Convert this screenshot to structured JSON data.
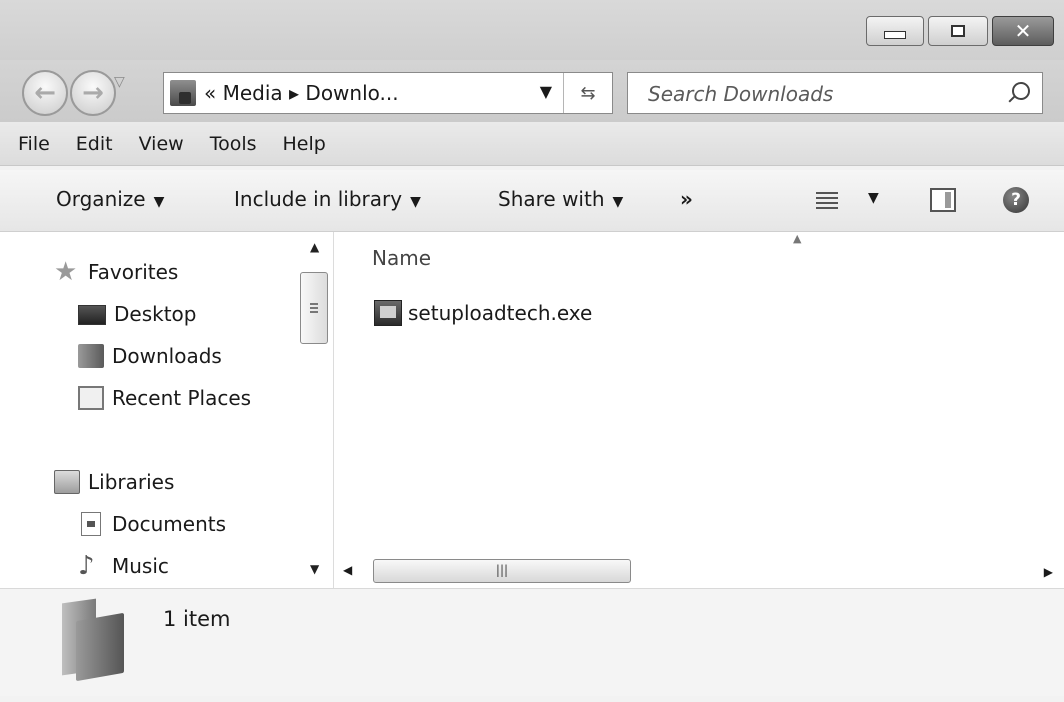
{
  "window": {
    "controls": {
      "minimize": "minimize-icon",
      "restore": "restore-icon",
      "close": "close-icon"
    }
  },
  "nav": {
    "address": {
      "path_text": "« Media ▸ Downlo..."
    },
    "search": {
      "placeholder": "Search Downloads"
    }
  },
  "menubar": {
    "items": [
      "File",
      "Edit",
      "View",
      "Tools",
      "Help"
    ]
  },
  "toolbar": {
    "organize": "Organize",
    "include_in_library": "Include in library",
    "share_with": "Share with",
    "more": "»"
  },
  "sidebar": {
    "favorites_header": "Favorites",
    "favorites": [
      "Desktop",
      "Downloads",
      "Recent Places"
    ],
    "libraries_header": "Libraries",
    "libraries": [
      "Documents",
      "Music"
    ]
  },
  "content": {
    "column_name": "Name",
    "files": [
      {
        "name": "setuploadtech.exe"
      }
    ]
  },
  "details": {
    "item_count": "1 item"
  }
}
